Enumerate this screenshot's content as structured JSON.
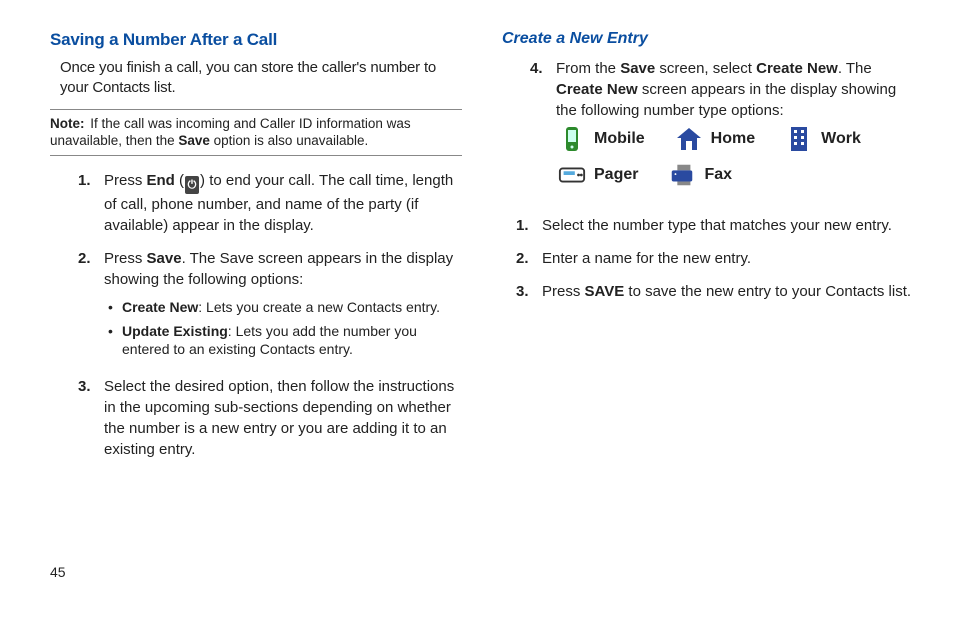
{
  "pageNumber": "45",
  "left": {
    "heading": "Saving a Number After a Call",
    "intro": "Once you finish a call, you can store the caller's number to your Contacts list.",
    "noteLabel": "Note:",
    "noteBody_a": "If the call was incoming and Caller ID information was unavailable, then the ",
    "noteBody_b": "Save",
    "noteBody_c": " option is also unavailable.",
    "step1_num": "1.",
    "step1_a": "Press ",
    "step1_b": "End",
    "step1_c": " (",
    "step1_d": ") to end your call. The call time, length of call, phone number, and name of the party (if available) appear in the display.",
    "step2_num": "2.",
    "step2_a": "Press ",
    "step2_b": "Save",
    "step2_c": ". The Save screen appears in the display showing the following options:",
    "bullet1_a": "Create New",
    "bullet1_b": ": Lets you create a new Contacts entry.",
    "bullet2_a": "Update Existing",
    "bullet2_b": ": Lets you add the number you entered to an existing Contacts entry.",
    "step3_num": "3.",
    "step3": "Select the desired option, then follow the instructions in the upcoming sub-sections depending on whether the number is a new entry or you are adding it to an existing entry."
  },
  "right": {
    "heading": "Create a New Entry",
    "step4_num": "4.",
    "step4_a": "From the ",
    "step4_b": "Save",
    "step4_c": " screen, select ",
    "step4_d": "Create New",
    "step4_e": ". The ",
    "step4_f": "Create New",
    "step4_g": " screen appears in the display showing the following number type options:",
    "types": {
      "mobile": "Mobile",
      "home": "Home",
      "work": "Work",
      "pager": "Pager",
      "fax": "Fax"
    },
    "s1_num": "1.",
    "s1": "Select the number type that matches your new entry.",
    "s2_num": "2.",
    "s2": "Enter a name for the new entry.",
    "s3_num": "3.",
    "s3_a": "Press ",
    "s3_b": "SAVE",
    "s3_c": " to save the new entry to your Contacts list."
  }
}
